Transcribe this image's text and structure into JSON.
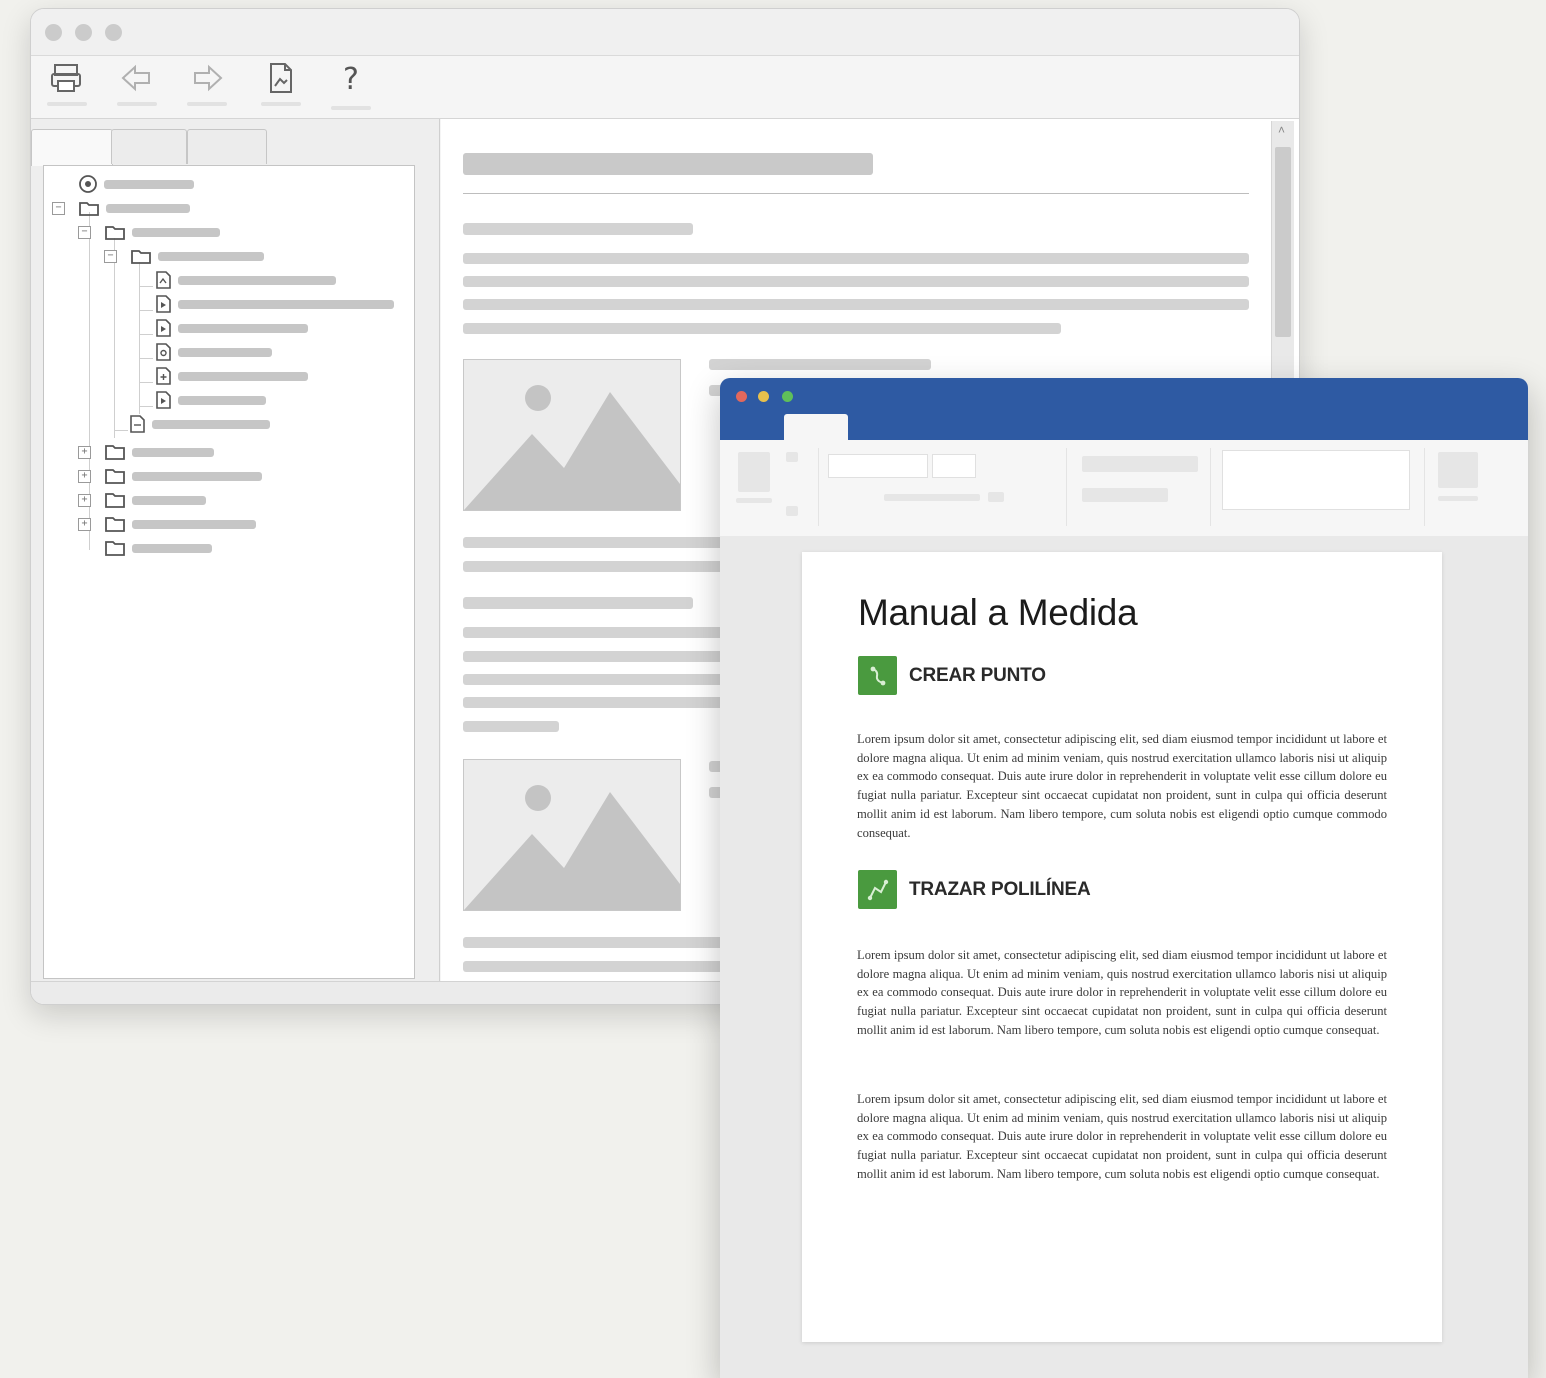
{
  "help_viewer": {
    "toolbar": {
      "help_button_glyph": "?",
      "icons": [
        "print-icon",
        "back-arrow-icon",
        "forward-arrow-icon",
        "page-view-icon",
        "question-mark-icon"
      ]
    },
    "scroll": {
      "left_arrow": "‹",
      "right_arrow": "›",
      "up_arrow": "˄"
    },
    "tree_expanders": {
      "collapse": "−",
      "expand": "+"
    }
  },
  "word_document": {
    "title": "Manual a Medida",
    "sections": [
      {
        "heading": "CREAR PUNTO",
        "icon": "point-tool-icon",
        "paragraphs": [
          "Lorem ipsum dolor sit amet, consectetur adipiscing elit, sed diam eiusmod tempor incididunt ut labore et dolore magna aliqua. Ut enim ad minim veniam, quis nostrud exercitation ullamco laboris nisi ut aliquip ex ea commodo consequat. Duis aute irure dolor in reprehenderit in voluptate velit esse cillum dolore eu fugiat nulla pariatur. Excepteur sint occaecat cupidatat non proident, sunt in culpa qui officia deserunt mollit anim id est laborum. Nam libero tempore, cum soluta nobis est eligendi optio cumque commodo consequat."
        ]
      },
      {
        "heading": "TRAZAR POLILÍNEA",
        "icon": "polyline-tool-icon",
        "paragraphs": [
          "Lorem ipsum dolor sit amet, consectetur adipiscing elit, sed diam eiusmod tempor incididunt ut labore et dolore magna aliqua. Ut enim ad minim veniam, quis nostrud exercitation ullamco laboris nisi ut aliquip ex ea commodo consequat. Duis aute irure dolor in reprehenderit in voluptate velit esse cillum dolore eu fugiat nulla pariatur. Excepteur sint occaecat cupidatat non proident, sunt in culpa qui officia deserunt mollit anim id est laborum. Nam libero tempore, cum soluta nobis est eligendi optio cumque consequat.",
          "Lorem ipsum dolor sit amet, consectetur adipiscing elit, sed diam eiusmod tempor incididunt ut labore et dolore magna aliqua. Ut enim ad minim veniam, quis nostrud exercitation ullamco laboris nisi ut aliquip ex ea commodo consequat. Duis aute irure dolor in reprehenderit in voluptate velit esse cillum dolore eu fugiat nulla pariatur. Excepteur sint occaecat cupidatat non proident, sunt in culpa qui officia deserunt mollit anim id est laborum. Nam libero tempore, cum soluta nobis est eligendi optio cumque consequat."
        ]
      }
    ]
  },
  "colors": {
    "word_titlebar": "#2e5aa3",
    "section_icon_green": "#4a9a3f",
    "placeholder_gray": "#c9c9c9"
  }
}
